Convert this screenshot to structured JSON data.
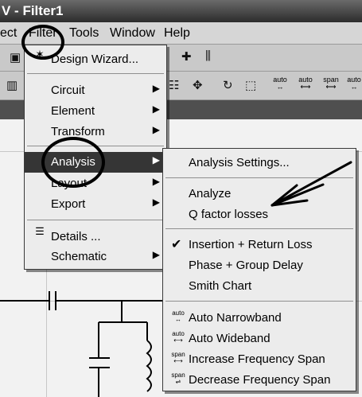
{
  "window": {
    "title": "V - Filter1"
  },
  "menubar": {
    "items": [
      "ect",
      "Filter",
      "Tools",
      "Window",
      "Help"
    ]
  },
  "filter_menu": {
    "design_wizard": "Design Wizard...",
    "circuit": "Circuit",
    "element": "Element",
    "transform": "Transform",
    "analysis": "Analysis",
    "layout": "Layout",
    "export": "Export",
    "details": "Details ...",
    "schematic": "Schematic"
  },
  "analysis_menu": {
    "settings": "Analysis Settings...",
    "analyze": "Analyze",
    "q_factor": "Q factor losses",
    "insertion": "Insertion + Return Loss",
    "phase": "Phase + Group Delay",
    "smith": "Smith Chart",
    "auto_narrow": "Auto Narrowband",
    "auto_wide": "Auto Wideband",
    "inc_span": "Increase Frequency Span",
    "dec_span": "Decrease Frequency Span"
  },
  "toolbar_labels": {
    "auto1": "auto",
    "auto2": "auto",
    "span1": "span",
    "auto3": "auto",
    "menu_auto1": "auto",
    "menu_auto2": "auto",
    "menu_span1": "span",
    "menu_span2": "span"
  }
}
